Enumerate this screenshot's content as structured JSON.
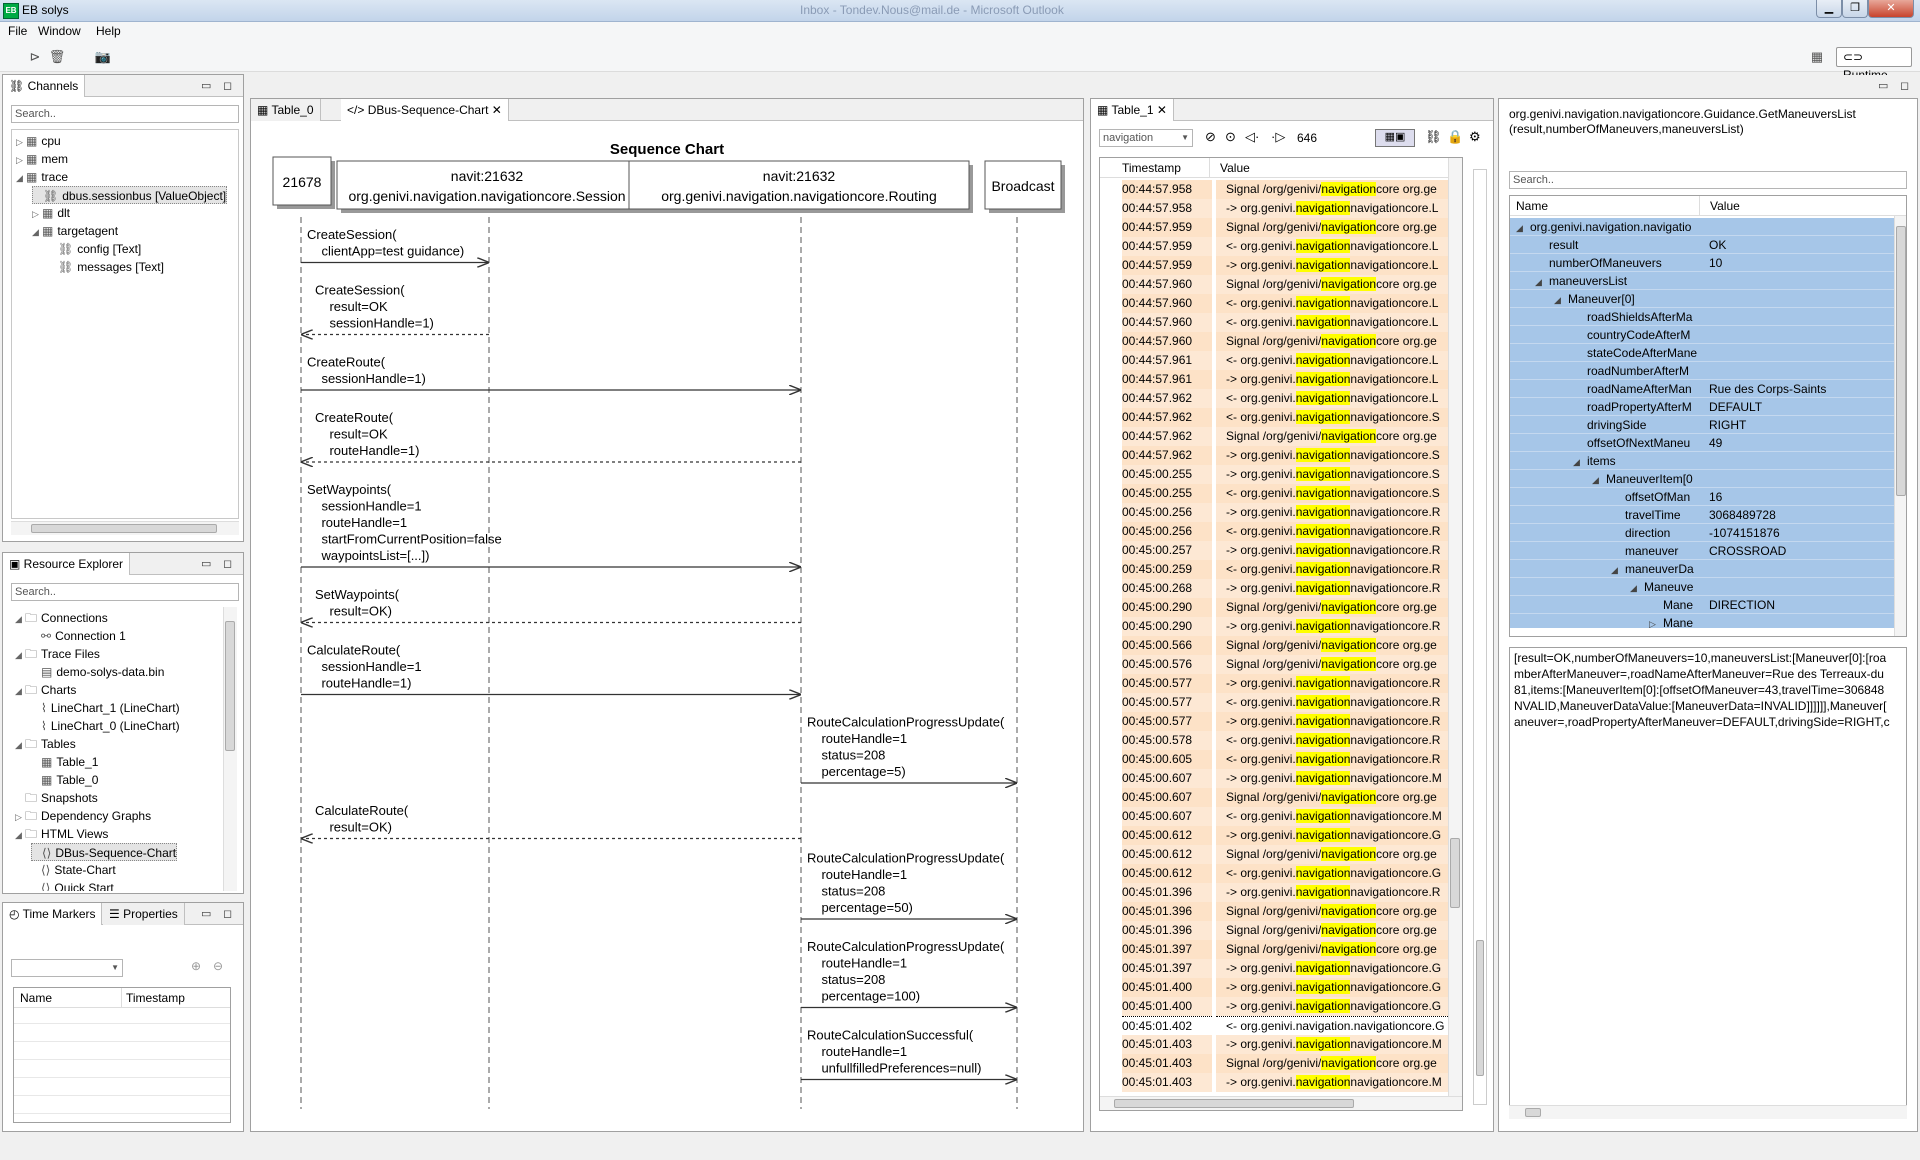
{
  "app": {
    "title": "EB solys",
    "bg_title": "Inbox - Tondev.Nous@mail.de - Microsoft Outlook",
    "runtime": "Runtime"
  },
  "menu": [
    "File",
    "Window",
    "Help"
  ],
  "channels": {
    "tab": "Channels",
    "search": "Search..",
    "items": [
      {
        "label": "cpu",
        "indent": 0,
        "twisty": "▷",
        "icon": "grid"
      },
      {
        "label": "mem",
        "indent": 0,
        "twisty": "▷",
        "icon": "grid"
      },
      {
        "label": "trace",
        "indent": 0,
        "twisty": "◢",
        "icon": "grid"
      },
      {
        "label": "dbus.sessionbus [ValueObject]",
        "indent": 1,
        "twisty": "",
        "icon": "chan",
        "selected": true
      },
      {
        "label": "dlt",
        "indent": 1,
        "twisty": "▷",
        "icon": "grid"
      },
      {
        "label": "targetagent",
        "indent": 1,
        "twisty": "◢",
        "icon": "grid"
      },
      {
        "label": "config [Text]",
        "indent": 2,
        "twisty": "",
        "icon": "chan"
      },
      {
        "label": "messages [Text]",
        "indent": 2,
        "twisty": "",
        "icon": "chan"
      }
    ]
  },
  "resources": {
    "tab": "Resource Explorer",
    "search": "Search..",
    "items": [
      {
        "label": "Connections",
        "indent": 0,
        "twisty": "◢",
        "icon": "folder"
      },
      {
        "label": "Connection 1",
        "indent": 1,
        "twisty": "",
        "icon": "plug"
      },
      {
        "label": "Trace Files",
        "indent": 0,
        "twisty": "◢",
        "icon": "folder"
      },
      {
        "label": "demo-solys-data.bin",
        "indent": 1,
        "twisty": "",
        "icon": "file"
      },
      {
        "label": "Charts",
        "indent": 0,
        "twisty": "◢",
        "icon": "folder"
      },
      {
        "label": "LineChart_1 (LineChart)",
        "indent": 1,
        "twisty": "",
        "icon": "chart"
      },
      {
        "label": "LineChart_0 (LineChart)",
        "indent": 1,
        "twisty": "",
        "icon": "chart"
      },
      {
        "label": "Tables",
        "indent": 0,
        "twisty": "◢",
        "icon": "folder"
      },
      {
        "label": "Table_1",
        "indent": 1,
        "twisty": "",
        "icon": "grid"
      },
      {
        "label": "Table_0",
        "indent": 1,
        "twisty": "",
        "icon": "grid"
      },
      {
        "label": "Snapshots",
        "indent": 0,
        "twisty": "",
        "icon": "folder"
      },
      {
        "label": "Dependency Graphs",
        "indent": 0,
        "twisty": "▷",
        "icon": "folder"
      },
      {
        "label": "HTML Views",
        "indent": 0,
        "twisty": "◢",
        "icon": "folder"
      },
      {
        "label": "DBus-Sequence-Chart",
        "indent": 1,
        "twisty": "",
        "icon": "html",
        "selected": true
      },
      {
        "label": "State-Chart",
        "indent": 1,
        "twisty": "",
        "icon": "html"
      },
      {
        "label": "Quick Start",
        "indent": 1,
        "twisty": "",
        "icon": "html"
      }
    ]
  },
  "timemarkers": {
    "tab1": "Time Markers",
    "tab2": "Properties",
    "col_name": "Name",
    "col_timestamp": "Timestamp"
  },
  "editor": {
    "tab1": "Table_0",
    "tab2": "DBus-Sequence-Chart"
  },
  "seq": {
    "title": "Sequence Chart",
    "participants": [
      {
        "line1": "21678",
        "line2": ""
      },
      {
        "line1": "navit:21632",
        "line2": "org.genivi.navigation.navigationcore.Session"
      },
      {
        "line1": "navit:21632",
        "line2": "org.genivi.navigation.navigationcore.Routing"
      },
      {
        "line1": "Broadcast",
        "line2": ""
      }
    ],
    "messages": [
      {
        "from": 0,
        "to": 1,
        "dashed": false,
        "lines": [
          "CreateSession(",
          "    clientApp=test guidance)"
        ]
      },
      {
        "from": 1,
        "to": 0,
        "dashed": true,
        "lines": [
          "CreateSession(",
          "    result=OK",
          "    sessionHandle=1)"
        ]
      },
      {
        "from": 0,
        "to": 2,
        "dashed": false,
        "lines": [
          "CreateRoute(",
          "    sessionHandle=1)"
        ]
      },
      {
        "from": 2,
        "to": 0,
        "dashed": true,
        "lines": [
          "CreateRoute(",
          "    result=OK",
          "    routeHandle=1)"
        ]
      },
      {
        "from": 0,
        "to": 2,
        "dashed": false,
        "lines": [
          "SetWaypoints(",
          "    sessionHandle=1",
          "    routeHandle=1",
          "    startFromCurrentPosition=false",
          "    waypointsList=[...])"
        ]
      },
      {
        "from": 2,
        "to": 0,
        "dashed": true,
        "lines": [
          "SetWaypoints(",
          "    result=OK)"
        ]
      },
      {
        "from": 0,
        "to": 2,
        "dashed": false,
        "lines": [
          "CalculateRoute(",
          "    sessionHandle=1",
          "    routeHandle=1)"
        ]
      },
      {
        "from": 2,
        "to": 3,
        "dashed": false,
        "lines": [
          "RouteCalculationProgressUpdate(",
          "    routeHandle=1",
          "    status=208",
          "    percentage=5)"
        ]
      },
      {
        "from": 2,
        "to": 0,
        "dashed": true,
        "lines": [
          "CalculateRoute(",
          "    result=OK)"
        ]
      },
      {
        "from": 2,
        "to": 3,
        "dashed": false,
        "lines": [
          "RouteCalculationProgressUpdate(",
          "    routeHandle=1",
          "    status=208",
          "    percentage=50)"
        ]
      },
      {
        "from": 2,
        "to": 3,
        "dashed": false,
        "lines": [
          "RouteCalculationProgressUpdate(",
          "    routeHandle=1",
          "    status=208",
          "    percentage=100)"
        ]
      },
      {
        "from": 2,
        "to": 3,
        "dashed": false,
        "lines": [
          "RouteCalculationSuccessful(",
          "    routeHandle=1",
          "    unfullfilledPreferences=null)"
        ]
      }
    ]
  },
  "table1": {
    "tab": "Table_1",
    "filter": "navigation",
    "count": "646",
    "col_ts": "Timestamp",
    "col_val": "Value",
    "rows": [
      [
        "00:44:57.958",
        "Signal /org/genivi/",
        "navigation",
        "core org.ge"
      ],
      [
        "00:44:57.958",
        "-> org.genivi.",
        "navigation",
        "navigationcore.L"
      ],
      [
        "00:44:57.959",
        "Signal /org/genivi/",
        "navigation",
        "core org.ge"
      ],
      [
        "00:44:57.959",
        "<- org.genivi.",
        "navigation",
        "navigationcore.L"
      ],
      [
        "00:44:57.959",
        "-> org.genivi.",
        "navigation",
        "navigationcore.L"
      ],
      [
        "00:44:57.960",
        "Signal /org/genivi/",
        "navigation",
        "core org.ge"
      ],
      [
        "00:44:57.960",
        "<- org.genivi.",
        "navigation",
        "navigationcore.L"
      ],
      [
        "00:44:57.960",
        "<- org.genivi.",
        "navigation",
        "navigationcore.L"
      ],
      [
        "00:44:57.960",
        "Signal /org/genivi/",
        "navigation",
        "core org.ge"
      ],
      [
        "00:44:57.961",
        "<- org.genivi.",
        "navigation",
        "navigationcore.L"
      ],
      [
        "00:44:57.961",
        "-> org.genivi.",
        "navigation",
        "navigationcore.L"
      ],
      [
        "00:44:57.962",
        "<- org.genivi.",
        "navigation",
        "navigationcore.L"
      ],
      [
        "00:44:57.962",
        "<- org.genivi.",
        "navigation",
        "navigationcore.S"
      ],
      [
        "00:44:57.962",
        "Signal /org/genivi/",
        "navigation",
        "core org.ge"
      ],
      [
        "00:44:57.962",
        "-> org.genivi.",
        "navigation",
        "navigationcore.S"
      ],
      [
        "00:45:00.255",
        "-> org.genivi.",
        "navigation",
        "navigationcore.S"
      ],
      [
        "00:45:00.255",
        "<- org.genivi.",
        "navigation",
        "navigationcore.S"
      ],
      [
        "00:45:00.256",
        "-> org.genivi.",
        "navigation",
        "navigationcore.R"
      ],
      [
        "00:45:00.256",
        "<- org.genivi.",
        "navigation",
        "navigationcore.R"
      ],
      [
        "00:45:00.257",
        "-> org.genivi.",
        "navigation",
        "navigationcore.R"
      ],
      [
        "00:45:00.259",
        "<- org.genivi.",
        "navigation",
        "navigationcore.R"
      ],
      [
        "00:45:00.268",
        "-> org.genivi.",
        "navigation",
        "navigationcore.R"
      ],
      [
        "00:45:00.290",
        "Signal /org/genivi/",
        "navigation",
        "core org.ge"
      ],
      [
        "00:45:00.290",
        "-> org.genivi.",
        "navigation",
        "navigationcore.R"
      ],
      [
        "00:45:00.566",
        "Signal /org/genivi/",
        "navigation",
        "core org.ge"
      ],
      [
        "00:45:00.576",
        "Signal /org/genivi/",
        "navigation",
        "core org.ge"
      ],
      [
        "00:45:00.577",
        "-> org.genivi.",
        "navigation",
        "navigationcore.R"
      ],
      [
        "00:45:00.577",
        "<- org.genivi.",
        "navigation",
        "navigationcore.R"
      ],
      [
        "00:45:00.577",
        "-> org.genivi.",
        "navigation",
        "navigationcore.R"
      ],
      [
        "00:45:00.578",
        "<- org.genivi.",
        "navigation",
        "navigationcore.R"
      ],
      [
        "00:45:00.605",
        "<- org.genivi.",
        "navigation",
        "navigationcore.R"
      ],
      [
        "00:45:00.607",
        "-> org.genivi.",
        "navigation",
        "navigationcore.M"
      ],
      [
        "00:45:00.607",
        "Signal /org/genivi/",
        "navigation",
        "core org.ge"
      ],
      [
        "00:45:00.607",
        "<- org.genivi.",
        "navigation",
        "navigationcore.M"
      ],
      [
        "00:45:00.612",
        "-> org.genivi.",
        "navigation",
        "navigationcore.G"
      ],
      [
        "00:45:00.612",
        "Signal /org/genivi/",
        "navigation",
        "core org.ge"
      ],
      [
        "00:45:00.612",
        "<- org.genivi.",
        "navigation",
        "navigationcore.G"
      ],
      [
        "00:45:01.396",
        "-> org.genivi.",
        "navigation",
        "navigationcore.R"
      ],
      [
        "00:45:01.396",
        "Signal /org/genivi/",
        "navigation",
        "core org.ge"
      ],
      [
        "00:45:01.396",
        "Signal /org/genivi/",
        "navigation",
        "core org.ge"
      ],
      [
        "00:45:01.397",
        "Signal /org/genivi/",
        "navigation",
        "core org.ge"
      ],
      [
        "00:45:01.397",
        "-> org.genivi.",
        "navigation",
        "navigationcore.G"
      ],
      [
        "00:45:01.400",
        "-> org.genivi.",
        "navigation",
        "navigationcore.G"
      ],
      [
        "00:45:01.400",
        "-> org.genivi.",
        "navigation",
        "navigationcore.G"
      ],
      [
        "00:45:01.402",
        "<- org.genivi.navigation.navigationcore.G",
        "",
        ""
      ],
      [
        "00:45:01.403",
        "-> org.genivi.",
        "navigation",
        "navigationcore.M"
      ],
      [
        "00:45:01.403",
        "Signal /org/genivi/",
        "navigation",
        "core org.ge"
      ],
      [
        "00:45:01.403",
        "-> org.genivi.",
        "navigation",
        "navigationcore.M"
      ]
    ]
  },
  "detail": {
    "header": "org.genivi.navigation.navigationcore.Guidance.GetManeuversList",
    "header2": "(result,numberOfManeuvers,maneuversList)",
    "search": "Search..",
    "col_name": "Name",
    "col_value": "Value",
    "rows": [
      {
        "n": "org.genivi.navigation.navigatio",
        "v": "",
        "d": 0,
        "t": "◢"
      },
      {
        "n": "result",
        "v": "OK",
        "d": 1,
        "t": ""
      },
      {
        "n": "numberOfManeuvers",
        "v": "10",
        "d": 1,
        "t": ""
      },
      {
        "n": "maneuversList",
        "v": "",
        "d": 1,
        "t": "◢"
      },
      {
        "n": "Maneuver[0]",
        "v": "",
        "d": 2,
        "t": "◢"
      },
      {
        "n": "roadShieldsAfterMa",
        "v": "",
        "d": 3,
        "t": ""
      },
      {
        "n": "countryCodeAfterM",
        "v": "",
        "d": 3,
        "t": ""
      },
      {
        "n": "stateCodeAfterMane",
        "v": "",
        "d": 3,
        "t": ""
      },
      {
        "n": "roadNumberAfterM",
        "v": "",
        "d": 3,
        "t": ""
      },
      {
        "n": "roadNameAfterMan",
        "v": "Rue des Corps-Saints",
        "d": 3,
        "t": ""
      },
      {
        "n": "roadPropertyAfterM",
        "v": "DEFAULT",
        "d": 3,
        "t": ""
      },
      {
        "n": "drivingSide",
        "v": "RIGHT",
        "d": 3,
        "t": ""
      },
      {
        "n": "offsetOfNextManeu",
        "v": "49",
        "d": 3,
        "t": ""
      },
      {
        "n": "items",
        "v": "",
        "d": 3,
        "t": "◢"
      },
      {
        "n": "ManeuverItem[0",
        "v": "",
        "d": 4,
        "t": "◢"
      },
      {
        "n": "offsetOfMan",
        "v": "16",
        "d": 5,
        "t": ""
      },
      {
        "n": "travelTime",
        "v": "3068489728",
        "d": 5,
        "t": ""
      },
      {
        "n": "direction",
        "v": "-1074151876",
        "d": 5,
        "t": ""
      },
      {
        "n": "maneuver",
        "v": "CROSSROAD",
        "d": 5,
        "t": ""
      },
      {
        "n": "maneuverDa",
        "v": "",
        "d": 5,
        "t": "◢"
      },
      {
        "n": "Maneuve",
        "v": "",
        "d": 6,
        "t": "◢"
      },
      {
        "n": "Mane",
        "v": "DIRECTION",
        "d": 7,
        "t": ""
      },
      {
        "n": "Mane",
        "v": "",
        "d": 7,
        "t": "▷"
      }
    ],
    "raw": [
      "[result=OK,numberOfManeuvers=10,maneuversList:[Maneuver[0]:[roa",
      "mberAfterManeuver=,roadNameAfterManeuver=Rue des Terreaux-du",
      "81,items:[ManeuverItem[0]:[offsetOfManeuver=43,travelTime=306848",
      "NVALID,ManeuverDataValue:[ManeuverData=INVALID]]]]]],Maneuver[",
      "aneuver=,roadPropertyAfterManeuver=DEFAULT,drivingSide=RIGHT,c"
    ]
  }
}
